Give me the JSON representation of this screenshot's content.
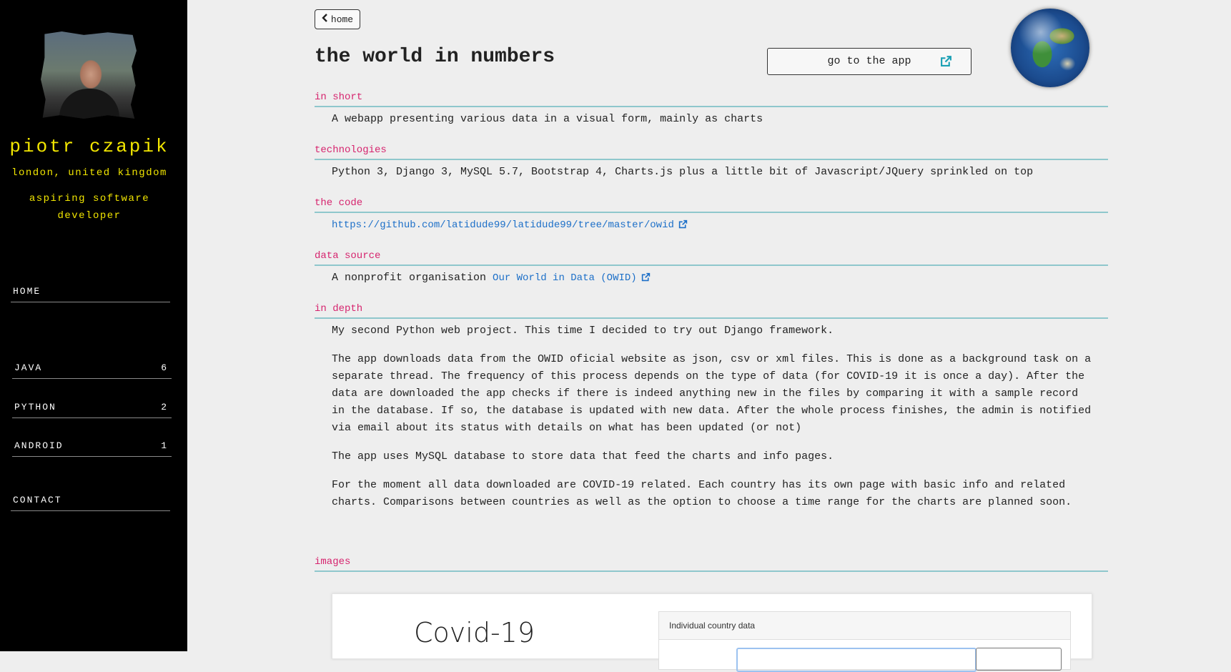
{
  "sidebar": {
    "name": "piotr czapik",
    "location": "london, united kingdom",
    "role": "aspiring software developer",
    "nav": [
      {
        "label": "HOME",
        "count": ""
      },
      {
        "label": "JAVA",
        "count": "6"
      },
      {
        "label": "PYTHON",
        "count": "2"
      },
      {
        "label": "ANDROID",
        "count": "1"
      },
      {
        "label": "CONTACT",
        "count": ""
      }
    ]
  },
  "header": {
    "home_label": "home",
    "title": "the world in numbers",
    "goto_label": "go to the app"
  },
  "sections": {
    "in_short": {
      "heading": "in short",
      "text": "A webapp presenting various data in a visual form, mainly as charts"
    },
    "technologies": {
      "heading": "technologies",
      "text": "Python 3, Django 3, MySQL 5.7, Bootstrap 4, Charts.js plus a little bit of Javascript/JQuery sprinkled on top"
    },
    "the_code": {
      "heading": "the code",
      "link": "https://github.com/latidude99/latidude99/tree/master/owid"
    },
    "data_source": {
      "heading": "data source",
      "prefix": "A nonprofit organisation ",
      "link": "Our World in Data (OWID)"
    },
    "in_depth": {
      "heading": "in depth",
      "p1": "My second Python web project. This time I decided to try out Django framework.",
      "p2": "The app downloads data from the OWID oficial website as json, csv or xml files. This is done as a background task on a separate thread. The frequency of this process depends on the type of data (for COVID-19 it is once a day). After the data are downloaded the app checks if there is indeed anything new in the files by comparing it with a sample record in the database. If so, the database is updated with new data. After the whole process finishes, the admin is notified via email about its status with details on what has been updated (or not)",
      "p3": "The app uses MySQL database to store data that feed the charts and info pages.",
      "p4": "For the moment all data downloaded are COVID-19 related. Each country has its own page with basic info and related charts. Comparisons between countries as well as the option to choose a time range for the charts are planned soon."
    },
    "images": {
      "heading": "images",
      "preview_title": "Covid-19",
      "preview_panel_title": "Individual country data"
    }
  },
  "colors": {
    "sidebar_bg": "#000000",
    "sidebar_text": "#f2e600",
    "heading": "#d6246e",
    "rule": "#8fc7cc",
    "link": "#1c6fc8",
    "external_icon": "#1aa0b4"
  },
  "icons": {
    "back": "chevron-left-icon",
    "external": "external-link-icon",
    "globe": "earth-globe-icon"
  }
}
